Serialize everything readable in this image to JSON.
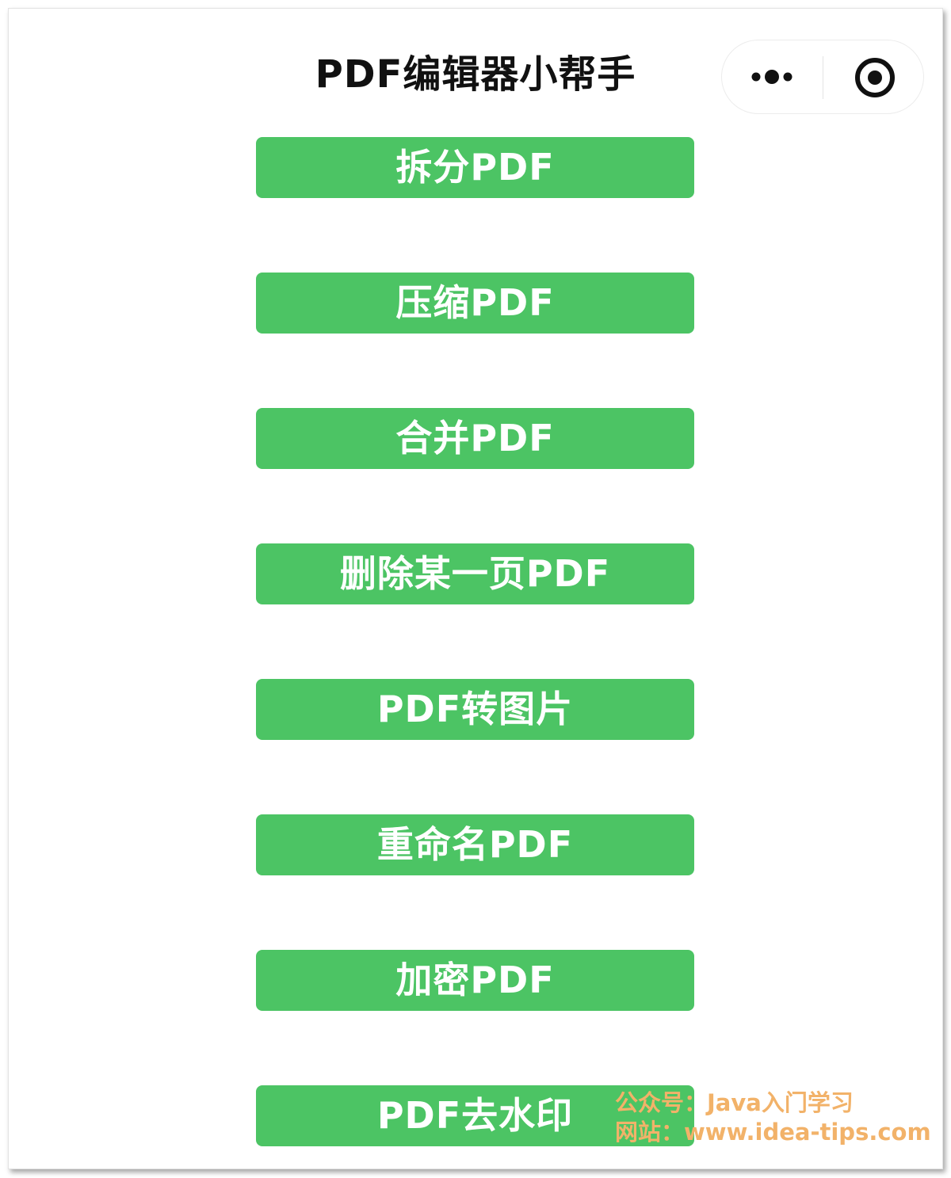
{
  "header": {
    "title": "PDF编辑器小帮手",
    "more_icon": "more-dots-icon",
    "close_icon": "target-close-icon"
  },
  "menu": {
    "items": [
      {
        "label": "拆分PDF"
      },
      {
        "label": "压缩PDF"
      },
      {
        "label": "合并PDF"
      },
      {
        "label": "删除某一页PDF"
      },
      {
        "label": "PDF转图片"
      },
      {
        "label": "重命名PDF"
      },
      {
        "label": "加密PDF"
      },
      {
        "label": "PDF去水印"
      }
    ]
  },
  "watermark": {
    "line1": "公众号：Java入门学习",
    "line2": "网站：www.idea-tips.com"
  },
  "colors": {
    "button_bg": "#4cc464",
    "button_text": "#ffffff",
    "title_text": "#111111",
    "watermark_text": "#f2b269"
  }
}
